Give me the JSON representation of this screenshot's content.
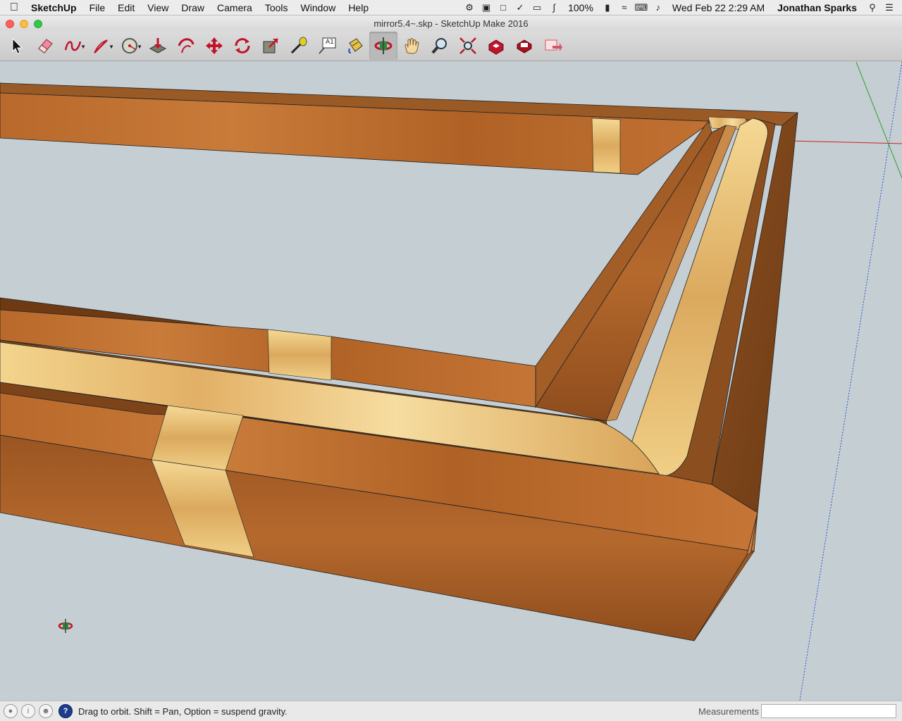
{
  "menubar": {
    "app_name": "SketchUp",
    "items": [
      "File",
      "Edit",
      "View",
      "Draw",
      "Camera",
      "Tools",
      "Window",
      "Help"
    ],
    "battery": "100%",
    "clock": "Wed Feb 22  2:29 AM",
    "user": "Jonathan Sparks"
  },
  "window": {
    "title": "mirror5.4~.skp - SketchUp Make 2016"
  },
  "toolbar": {
    "tools": [
      {
        "name": "select-tool",
        "icon": "select-arrow-icon"
      },
      {
        "name": "eraser-tool",
        "icon": "eraser-icon"
      },
      {
        "name": "freehand-tool",
        "icon": "freehand-icon"
      },
      {
        "name": "line-tool",
        "icon": "line-icon"
      },
      {
        "name": "circle-tool",
        "icon": "circle-icon"
      },
      {
        "name": "push-pull-tool",
        "icon": "push-pull-icon"
      },
      {
        "name": "offset-tool",
        "icon": "offset-icon"
      },
      {
        "name": "move-tool",
        "icon": "move-icon"
      },
      {
        "name": "rotate-tool",
        "icon": "rotate-icon"
      },
      {
        "name": "scale-tool",
        "icon": "scale-icon"
      },
      {
        "name": "tape-measure-tool",
        "icon": "tape-measure-icon"
      },
      {
        "name": "text-tool",
        "icon": "text-icon"
      },
      {
        "name": "paint-bucket-tool",
        "icon": "paint-bucket-icon"
      },
      {
        "name": "orbit-tool",
        "icon": "orbit-icon"
      },
      {
        "name": "pan-tool",
        "icon": "pan-hand-icon"
      },
      {
        "name": "zoom-tool",
        "icon": "zoom-icon"
      },
      {
        "name": "zoom-extents-tool",
        "icon": "zoom-extents-icon"
      },
      {
        "name": "3d-warehouse-tool",
        "icon": "warehouse-icon"
      },
      {
        "name": "extension-warehouse-tool",
        "icon": "extension-warehouse-icon"
      },
      {
        "name": "send-to-layout-tool",
        "icon": "layout-icon"
      }
    ],
    "text_tool_label": "A1"
  },
  "status": {
    "message": "Drag to orbit. Shift = Pan, Option = suspend gravity.",
    "measurements_label": "Measurements",
    "measurements_value": ""
  },
  "colors": {
    "viewport_bg": "#c5cfd3",
    "wood_dark": "#8a4f1f",
    "wood_mid": "#b86a2e",
    "wood_light": "#c98240",
    "maple": "#f0c77a"
  }
}
